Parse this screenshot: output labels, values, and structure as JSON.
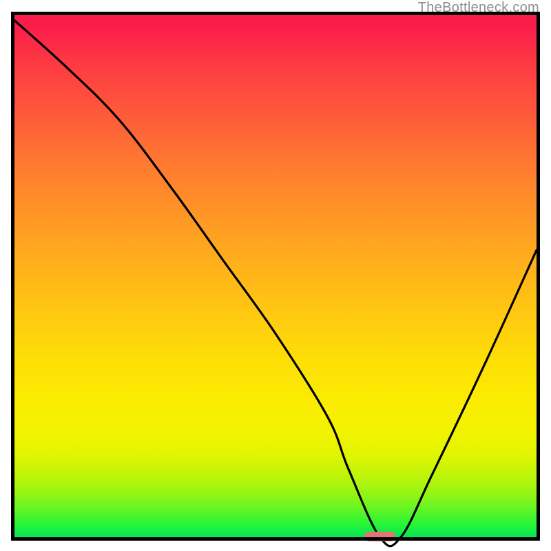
{
  "watermark": "TheBottleneck.com",
  "colors": {
    "marker": "#e57373",
    "curve": "#000000"
  },
  "chart_data": {
    "type": "line",
    "title": "",
    "xlabel": "",
    "ylabel": "",
    "xlim": [
      0,
      100
    ],
    "ylim": [
      0,
      100
    ],
    "grid": false,
    "legend": false,
    "background_gradient": {
      "top": "#fb1c4b",
      "bottom": "#06e457",
      "description": "red-to-green vertical gradient (red high, green low)"
    },
    "series": [
      {
        "name": "bottleneck-curve",
        "x": [
          0,
          10,
          20,
          30,
          40,
          50,
          60,
          64,
          70,
          74,
          80,
          90,
          100
        ],
        "y": [
          99,
          90,
          80,
          67,
          53,
          39,
          23,
          13,
          0,
          0,
          12,
          33,
          55
        ]
      }
    ],
    "marker": {
      "name": "optimal-zone",
      "x_start": 67,
      "x_end": 73,
      "y": 0
    },
    "annotations": []
  }
}
